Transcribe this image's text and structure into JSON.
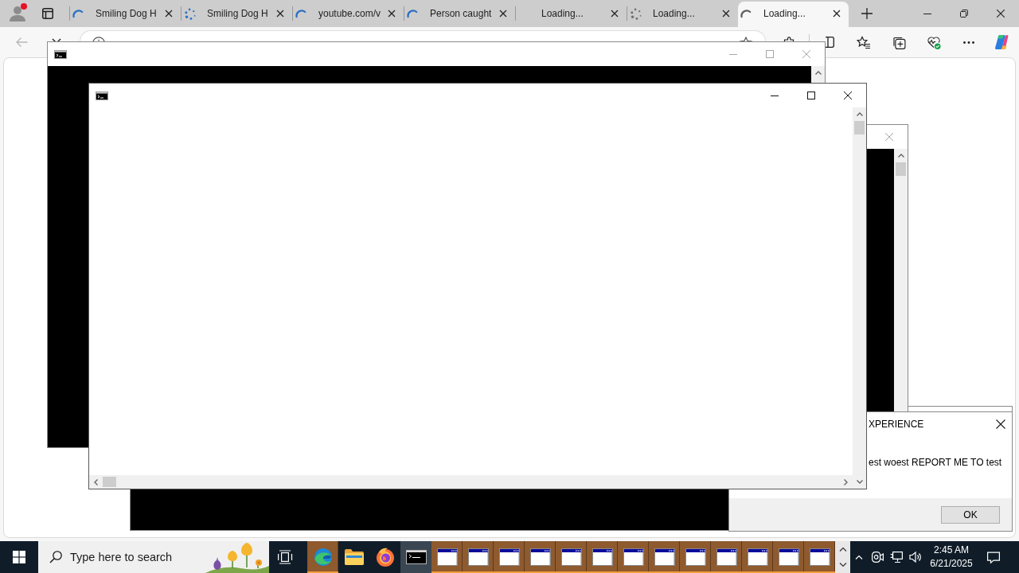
{
  "browser": {
    "profile": {
      "alert": true
    },
    "tabs": [
      {
        "title": "Smiling Dog H",
        "kind": "loading",
        "color": "#2a6fc4",
        "selected": false
      },
      {
        "title": "Smiling Dog H",
        "kind": "connecting",
        "color": "#2a6fc4",
        "selected": false
      },
      {
        "title": "youtube.com/v",
        "kind": "loading",
        "color": "#2a6fc4",
        "selected": false
      },
      {
        "title": "Person caught",
        "kind": "loading",
        "color": "#2a6fc4",
        "selected": false
      },
      {
        "title": "Loading...",
        "kind": "pending",
        "selected": false
      },
      {
        "title": "Loading...",
        "kind": "connecting",
        "color": "#6e6e6e",
        "selected": false
      },
      {
        "title": "Loading...",
        "kind": "loading",
        "color": "#5f5f5f",
        "selected": true
      }
    ],
    "back": {
      "disabled": true
    }
  },
  "desktop": {
    "windows": [
      {
        "kind": "console",
        "active": false,
        "title_icon": true,
        "color": "#000000",
        "title_buttons": [
          {
            "kind": "minimize"
          },
          {
            "kind": "maximize"
          },
          {
            "kind": "close"
          }
        ]
      },
      {
        "kind": "blank_dialog"
      },
      {
        "kind": "console",
        "active": false,
        "color": "#000000",
        "vertical_thumb": true,
        "title_buttons": [
          {
            "kind": "close"
          }
        ]
      },
      {
        "kind": "message_box",
        "title": "XPERIENCE",
        "message": "est woest REPORT ME TO test",
        "buttons": [
          "OK"
        ]
      },
      {
        "kind": "console",
        "active": true,
        "title_icon": true,
        "vertical_thumb": true,
        "horizontal_scrollbar": true,
        "title_buttons": [
          {
            "kind": "minimize"
          },
          {
            "kind": "maximize"
          },
          {
            "kind": "close"
          }
        ]
      }
    ]
  },
  "taskbar": {
    "search": {
      "placeholder": "Type here to search"
    },
    "buttons": [
      {
        "kind": "edge",
        "flashing": true,
        "active": false
      },
      {
        "kind": "explorer",
        "flashing": false,
        "active": false
      },
      {
        "kind": "firefox",
        "flashing": false,
        "active": false
      },
      {
        "kind": "console",
        "flashing": false,
        "active": true
      },
      {
        "kind": "window",
        "flashing": true,
        "active": false
      },
      {
        "kind": "window",
        "flashing": true,
        "active": false
      },
      {
        "kind": "window",
        "flashing": true,
        "active": false
      },
      {
        "kind": "window",
        "flashing": true,
        "active": false
      },
      {
        "kind": "window",
        "flashing": true,
        "active": false
      },
      {
        "kind": "window",
        "flashing": true,
        "active": false
      },
      {
        "kind": "window",
        "flashing": true,
        "active": false
      },
      {
        "kind": "window",
        "flashing": true,
        "active": false
      },
      {
        "kind": "window",
        "flashing": true,
        "active": false
      },
      {
        "kind": "window",
        "flashing": true,
        "active": false
      },
      {
        "kind": "window",
        "flashing": true,
        "active": false
      },
      {
        "kind": "window",
        "flashing": true,
        "active": false
      },
      {
        "kind": "window",
        "flashing": true,
        "active": false
      }
    ],
    "clock": {
      "time": "2:45 AM",
      "date": "6/21/2025"
    }
  }
}
